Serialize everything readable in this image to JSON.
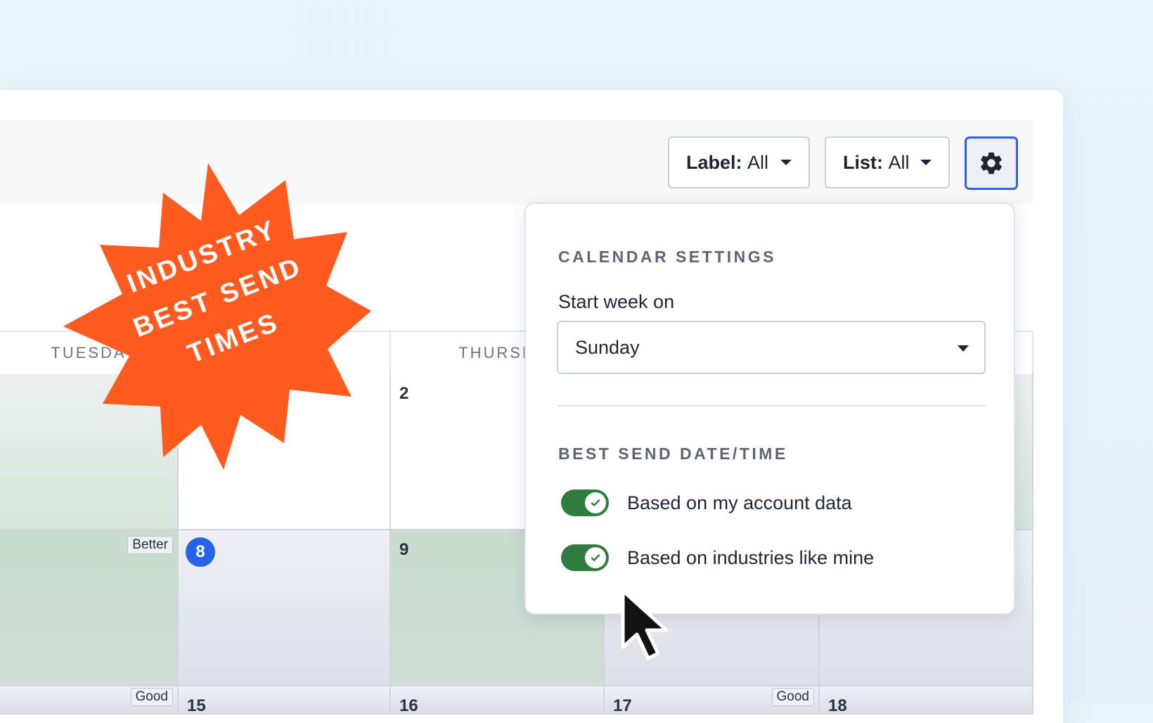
{
  "toolbar": {
    "label_filter": {
      "key": "Label:",
      "value": "All"
    },
    "list_filter": {
      "key": "List:",
      "value": "All"
    },
    "settings_icon": "gear-icon"
  },
  "calendar": {
    "day_headers": [
      "TUESDA",
      "THURSD"
    ],
    "row1": {
      "num_2": "2"
    },
    "row2": {
      "tag_better": "Better",
      "today": "8",
      "num_9": "9"
    },
    "row3": {
      "tag_good_1": "Good",
      "num_15": "15",
      "num_16": "16",
      "num_17": "17",
      "tag_good_2": "Good",
      "num_18": "18"
    }
  },
  "badge": {
    "lines": [
      "INDUSTRY",
      "BEST SEND",
      "TIMES"
    ],
    "color": "#ff5a1f"
  },
  "settings_panel": {
    "calendar_title": "CALENDAR SETTINGS",
    "start_week_label": "Start week on",
    "start_week_value": "Sunday",
    "best_send_title": "BEST SEND DATE/TIME",
    "toggle_account": "Based on my account data",
    "toggle_industry": "Based on industries like mine",
    "accent_green": "#2e7d3e",
    "accent_blue": "#2f62e0"
  }
}
